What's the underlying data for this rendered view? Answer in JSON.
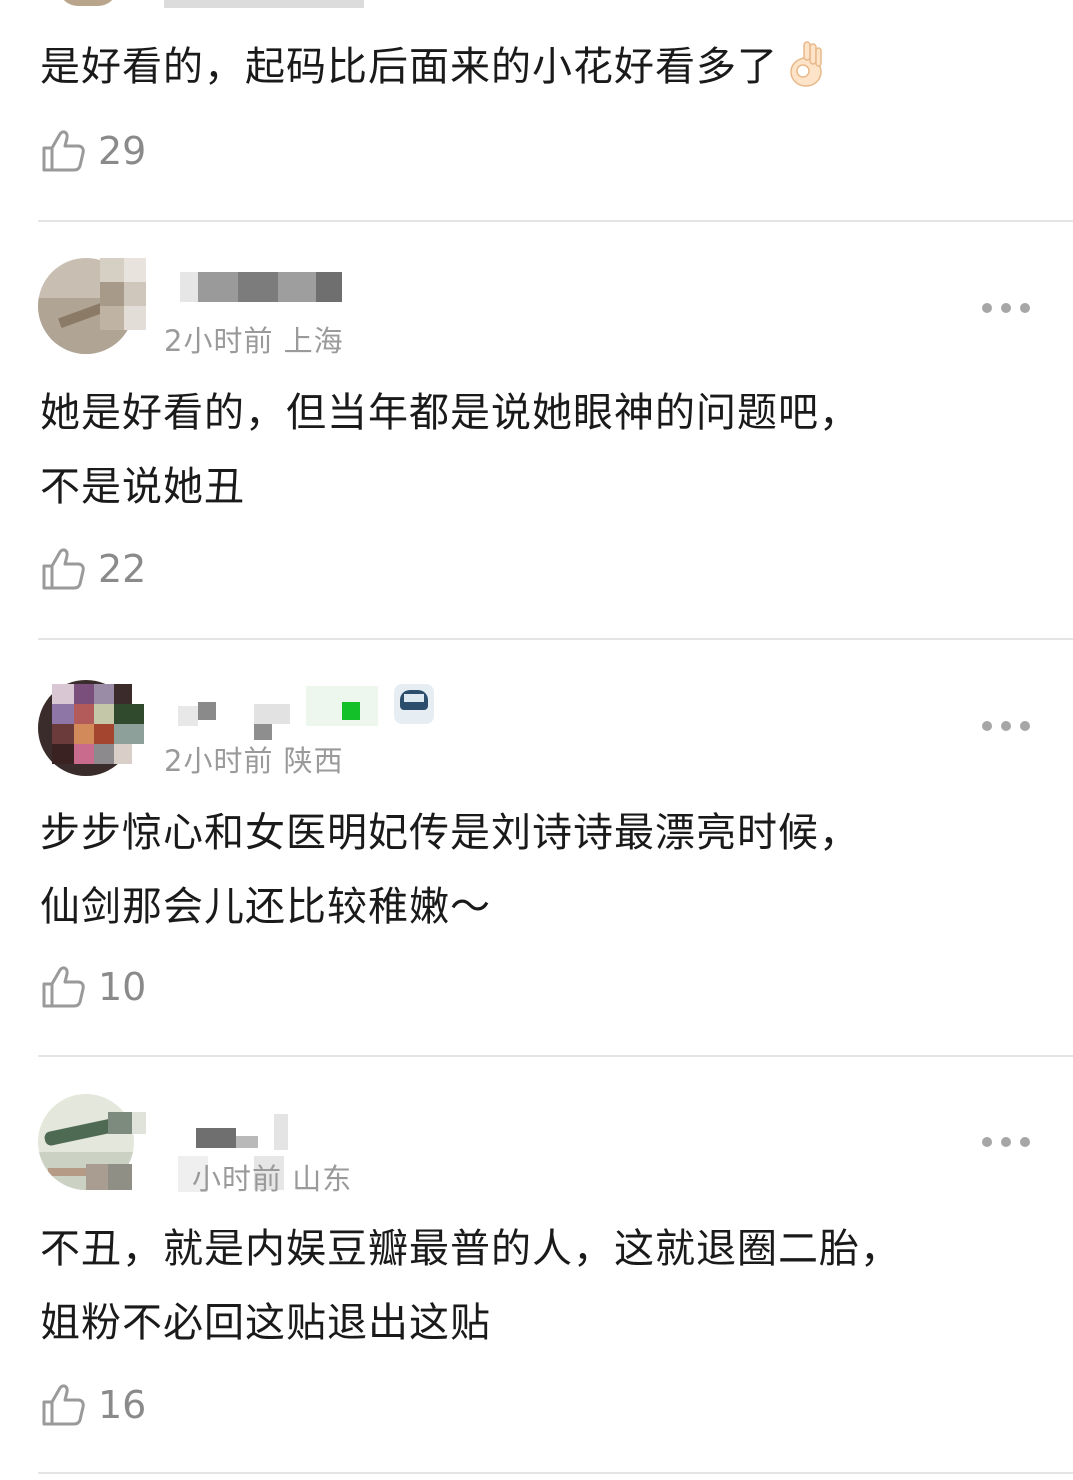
{
  "comments": [
    {
      "text_lines": [
        "是好看的，起码比后面来的小花好看多了"
      ],
      "emoji": "ok-hand-emoji",
      "likes": "29"
    },
    {
      "meta": "2小时前 上海",
      "text_lines": [
        "她是好看的，但当年都是说她眼神的问题吧，",
        "不是说她丑"
      ],
      "likes": "22"
    },
    {
      "meta": "2小时前 陕西",
      "text_lines": [
        "步步惊心和女医明妃传是刘诗诗最漂亮时候，",
        "仙剑那会儿还比较稚嫩～"
      ],
      "likes": "10"
    },
    {
      "meta": "小时前 山东",
      "text_lines": [
        "不丑，就是内娱豆瓣最普的人，这就退圈二胎，",
        "姐粉不必回这贴退出这贴"
      ],
      "likes": "16"
    }
  ],
  "icons": {
    "like": "thumbs-up-icon",
    "more": "more-dots-icon"
  },
  "colors": {
    "text": "#1a1a1a",
    "meta": "#9a9a9a",
    "like_count": "#8a8a8a",
    "divider": "#e4e4e4",
    "more_dots": "#a6a6a6"
  }
}
